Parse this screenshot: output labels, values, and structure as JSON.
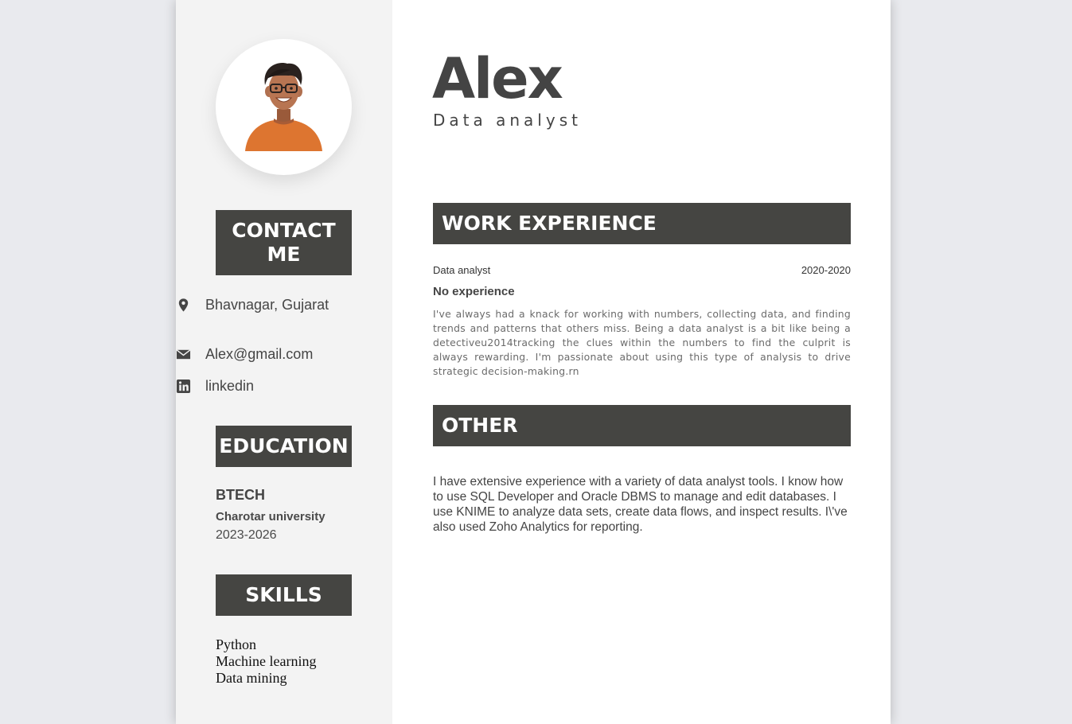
{
  "profile": {
    "name": "Alex",
    "role": "Data analyst",
    "avatar": {
      "icon": "person-avatar-illustration",
      "shirt_color": "#dd7530",
      "skin_color": "#b87552"
    }
  },
  "contact": {
    "heading": "CONTACT ME",
    "items": [
      {
        "icon": "location-pin-icon",
        "text": "Bhavnagar, Gujarat"
      },
      {
        "icon": "envelope-icon",
        "text": "Alex@gmail.com"
      },
      {
        "icon": "linkedin-icon",
        "text": "linkedin"
      }
    ]
  },
  "education": {
    "heading": "EDUCATION",
    "degree": "BTECH",
    "school": "Charotar university",
    "years": "2023-2026"
  },
  "skills": {
    "heading": "SKILLS",
    "items": [
      "Python",
      "Machine learning",
      "Data mining"
    ]
  },
  "work": {
    "heading": "WORK EXPERIENCE",
    "jobs": [
      {
        "title": "Data analyst",
        "dates": "2020-2020",
        "company": "No experience",
        "description": "I've always had a knack for working with numbers, collecting data, and finding trends and patterns that others miss. Being a data analyst is a bit like being a detectiveu2014tracking the clues within the numbers to find the culprit is always rewarding. I'm passionate about using this type of analysis to drive strategic decision-making.rn"
      }
    ]
  },
  "other": {
    "heading": "OTHER",
    "text": "I have extensive experience with a variety of data analyst tools. I know how to use SQL Developer and Oracle DBMS to manage and edit databases. I use KNIME to analyze data sets, create data flows, and inspect results. I\\'ve also used Zoho Analytics for reporting."
  },
  "colors": {
    "heading_bg": "#454542",
    "sidebar_bg": "#f3f3f3",
    "page_bg": "#e9eaee"
  }
}
